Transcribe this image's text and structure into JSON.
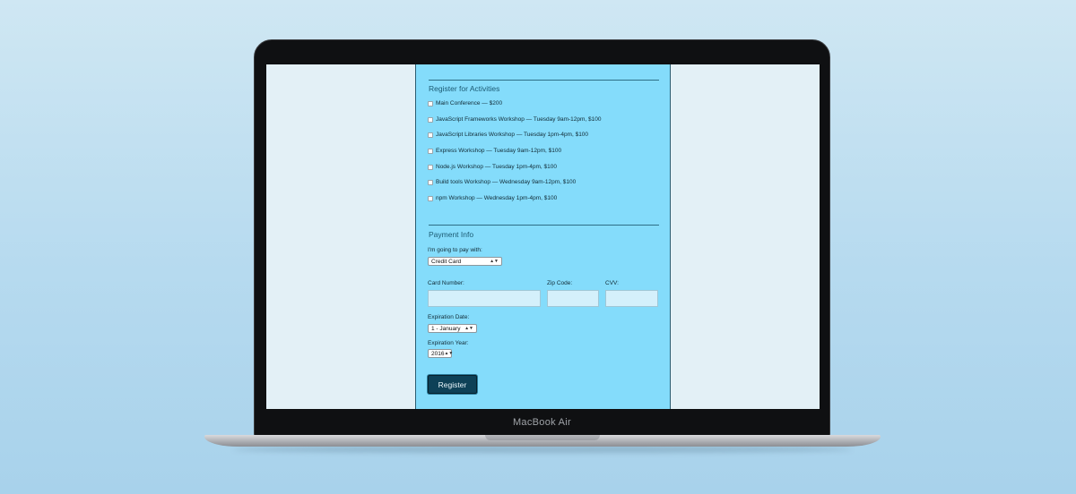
{
  "device": {
    "label": "MacBook Air"
  },
  "activities": {
    "legend": "Register for Activities",
    "items": [
      {
        "label": "Main Conference — $200"
      },
      {
        "label": "JavaScript Frameworks Workshop — Tuesday 9am-12pm, $100"
      },
      {
        "label": "JavaScript Libraries Workshop — Tuesday 1pm-4pm, $100"
      },
      {
        "label": "Express Workshop — Tuesday 9am-12pm, $100"
      },
      {
        "label": "Node.js Workshop — Tuesday 1pm-4pm, $100"
      },
      {
        "label": "Build tools Workshop — Wednesday 9am-12pm, $100"
      },
      {
        "label": "npm Workshop — Wednesday 1pm-4pm, $100"
      }
    ]
  },
  "payment": {
    "legend": "Payment Info",
    "pay_with_label": "I'm going to pay with:",
    "pay_with_value": "Credit Card",
    "card_number_label": "Card Number:",
    "zip_label": "Zip Code:",
    "cvv_label": "CVV:",
    "exp_date_label": "Expiration Date:",
    "exp_date_value": "1 - January",
    "exp_year_label": "Expiration Year:",
    "exp_year_value": "2016"
  },
  "register_button": "Register",
  "colors": {
    "form_background": "#84dcfb",
    "button": "#0e4157",
    "page_background": "#e3f0f6"
  }
}
